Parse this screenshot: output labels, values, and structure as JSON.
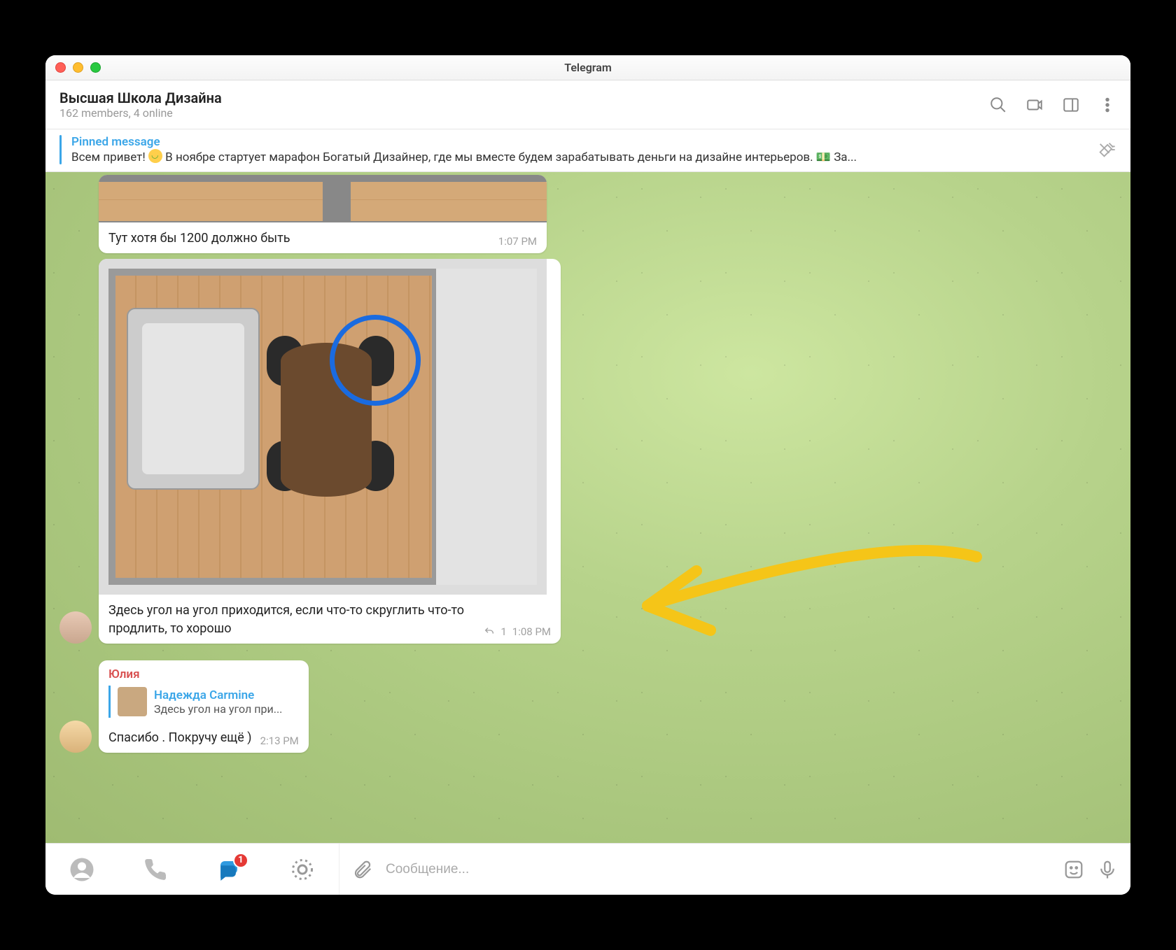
{
  "window": {
    "title": "Telegram"
  },
  "header": {
    "chat_title": "Высшая Школа Дизайна",
    "subtitle": "162 members, 4 online"
  },
  "pinned": {
    "label": "Pinned message",
    "text_before": "Всем привет! ",
    "text_after": "   В ноябре стартует марафон Богатый Дизайнер, где мы вместе будем зарабатывать деньги на дизайне интерьеров. 💵  За..."
  },
  "messages": {
    "m1": {
      "text": "Тут хотя бы 1200 должно быть",
      "time": "1:07 PM"
    },
    "m2": {
      "text": "Здесь угол на угол приходится, если что-то скруглить что-то продлить, то хорошо",
      "replies": "1",
      "time": "1:08 PM"
    },
    "m3": {
      "sender": "Юлия",
      "reply_to_name": "Надежда Carmine",
      "reply_to_text": "Здесь угол на угол при...",
      "text": "Спасибо . Покручу ещё )",
      "time": "2:13 PM"
    }
  },
  "footer": {
    "unread_badge": "1",
    "placeholder": "Сообщение..."
  }
}
